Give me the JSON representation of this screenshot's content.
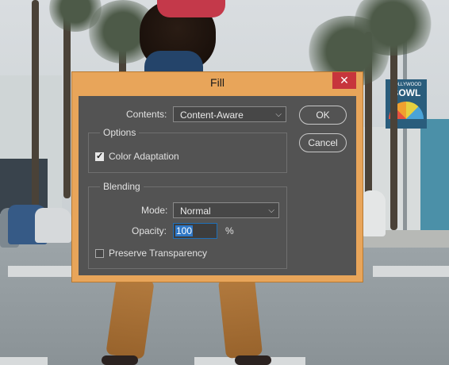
{
  "dialog": {
    "title": "Fill",
    "close_icon": "close-icon"
  },
  "contents": {
    "label": "Contents:",
    "value": "Content-Aware"
  },
  "options": {
    "legend": "Options",
    "color_adaptation": {
      "label": "Color Adaptation",
      "checked": true
    }
  },
  "blending": {
    "legend": "Blending",
    "mode_label": "Mode:",
    "mode_value": "Normal",
    "opacity_label": "Opacity:",
    "opacity_value": "100",
    "opacity_unit": "%",
    "preserve_transparency": {
      "label": "Preserve Transparency",
      "checked": false
    }
  },
  "buttons": {
    "ok": "OK",
    "cancel": "Cancel"
  },
  "background_sign": {
    "line1": "HOLLYWOOD",
    "line2": "BOWL"
  },
  "colors": {
    "titlebar": "#e8a55a",
    "client": "#535353",
    "close": "#c7353c",
    "selection": "#2f78c7"
  }
}
